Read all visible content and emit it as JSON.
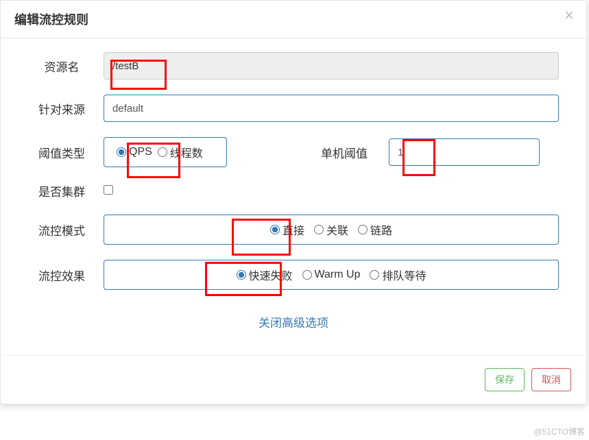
{
  "modal": {
    "title": "编辑流控规则",
    "close_advanced": "关闭高级选项"
  },
  "form": {
    "resource": {
      "label": "资源名",
      "value": "/testB"
    },
    "limit_app": {
      "label": "针对来源",
      "value": "default"
    },
    "threshold_type": {
      "label": "阈值类型",
      "options": {
        "qps": "QPS",
        "threads": "线程数"
      },
      "selected": "qps"
    },
    "single_threshold": {
      "label": "单机阈值",
      "value": "1"
    },
    "is_cluster": {
      "label": "是否集群",
      "checked": false
    },
    "mode": {
      "label": "流控模式",
      "options": {
        "direct": "直接",
        "relate": "关联",
        "chain": "链路"
      },
      "selected": "direct"
    },
    "effect": {
      "label": "流控效果",
      "options": {
        "fail_fast": "快速失败",
        "warm_up": "Warm Up",
        "queue": "排队等待"
      },
      "selected": "fail_fast"
    }
  },
  "footer": {
    "save": "保存",
    "cancel": "取消"
  },
  "watermark": "@51CTO博客"
}
